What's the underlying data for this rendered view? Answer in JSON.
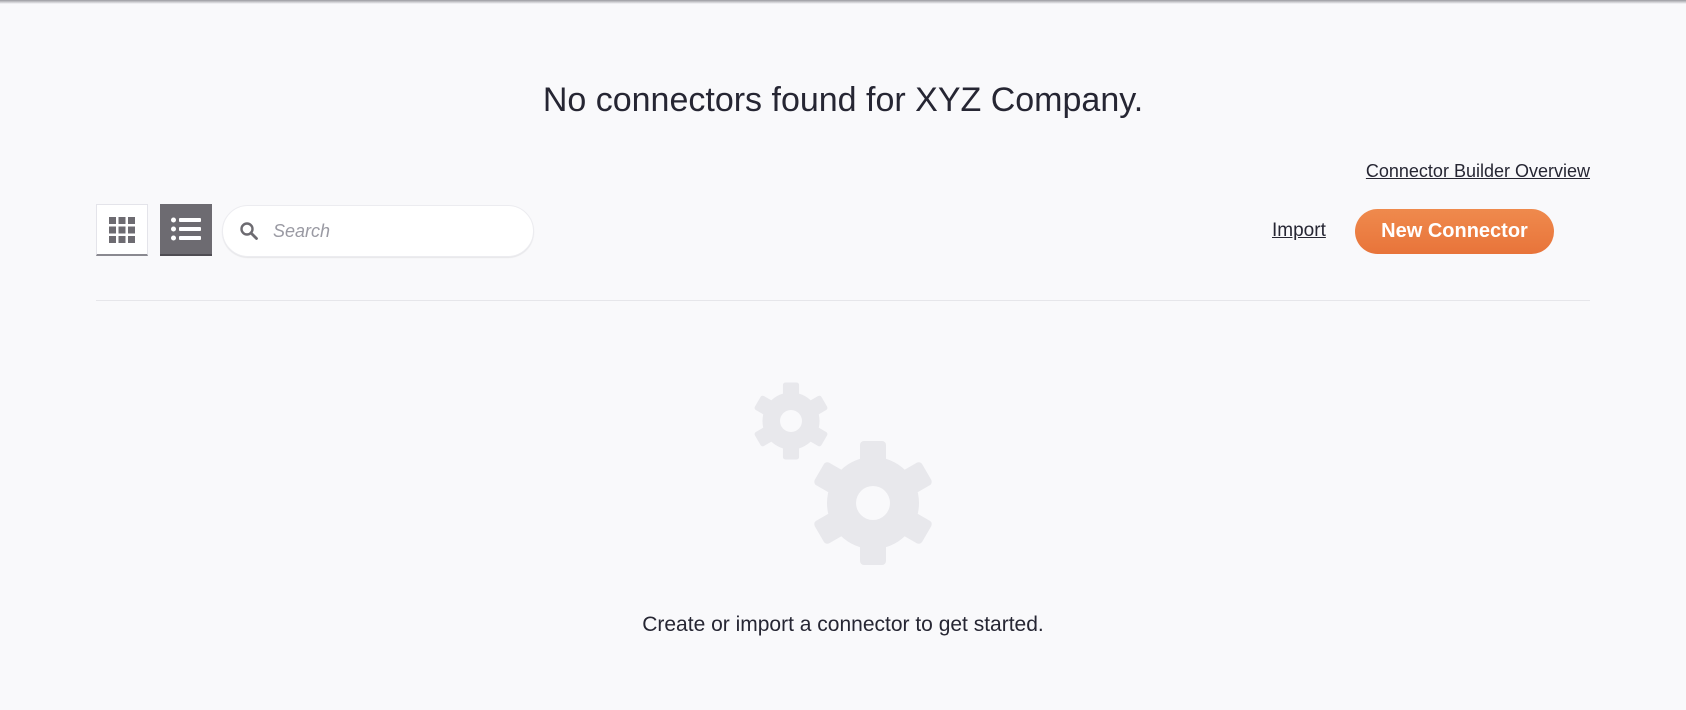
{
  "header": {
    "title": "No connectors found for XYZ Company."
  },
  "links": {
    "overview_label": "Connector Builder Overview",
    "import_label": "Import"
  },
  "toolbar": {
    "grid_view_icon": "grid-icon",
    "list_view_icon": "list-icon",
    "selected_view": "list",
    "search_icon": "search-icon",
    "new_connector_label": "New Connector"
  },
  "search": {
    "placeholder": "Search",
    "value": ""
  },
  "empty_state": {
    "icon": "gears-icon",
    "message": "Create or import a connector to get started."
  },
  "colors": {
    "background": "#f9f9fb",
    "accent": "#ec7d43",
    "selected_view_bg": "#6d6b71",
    "text": "#262633",
    "icon_muted": "#e8e8ec"
  }
}
